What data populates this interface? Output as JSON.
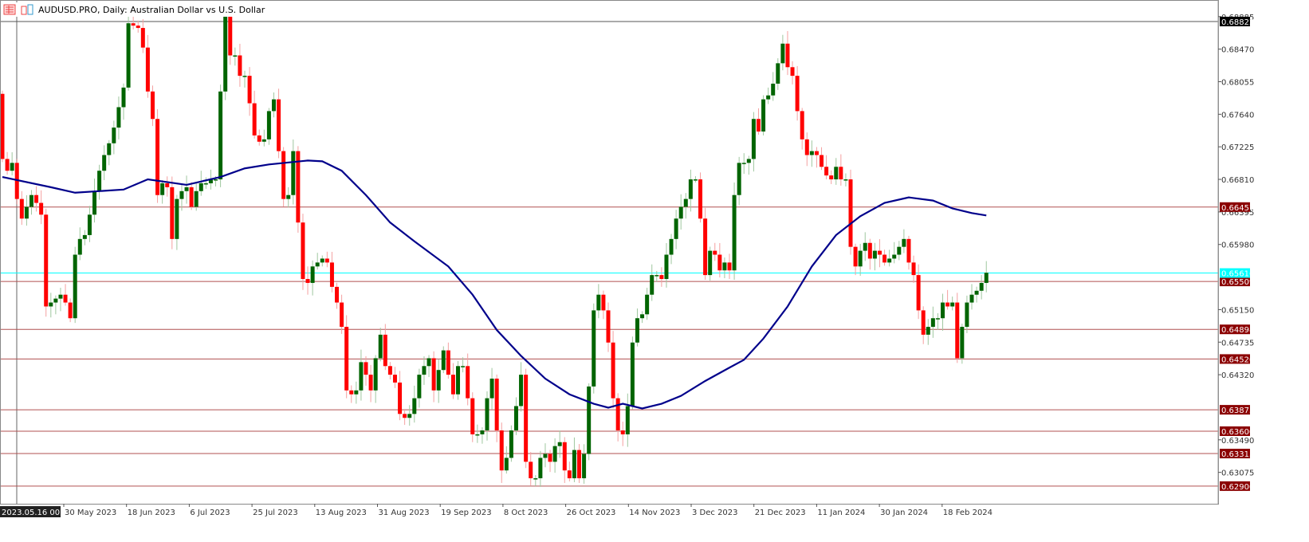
{
  "header": {
    "title": "AUDUSD.PRO, Daily:  Australian Dollar vs U.S. Dollar"
  },
  "colors": {
    "bull": "#006400",
    "bear": "#ff0000",
    "ma": "#00008b",
    "level": "#8b0000",
    "bid": "#00ffff",
    "grid_border": "#000000"
  },
  "chart_data": {
    "type": "candlestick",
    "symbol": "AUDUSD.PRO",
    "timeframe": "Daily",
    "ylim": [
      0.627,
      0.6905
    ],
    "closes": [
      0.6707,
      0.6692,
      0.6702,
      0.6656,
      0.6631,
      0.6646,
      0.6661,
      0.6651,
      0.6636,
      0.6519,
      0.6524,
      0.6529,
      0.6534,
      0.6524,
      0.6504,
      0.6585,
      0.6605,
      0.661,
      0.6636,
      0.6666,
      0.6692,
      0.6712,
      0.6727,
      0.6747,
      0.6773,
      0.6798,
      0.688,
      0.6877,
      0.6874,
      0.6849,
      0.6793,
      0.6758,
      0.6661,
      0.6676,
      0.6671,
      0.6605,
      0.6656,
      0.6666,
      0.6671,
      0.6646,
      0.6666,
      0.6676,
      0.6676,
      0.6681,
      0.6681,
      0.6793,
      0.689,
      0.6839,
      0.6839,
      0.6813,
      0.6813,
      0.6778,
      0.6737,
      0.6729,
      0.6732,
      0.6768,
      0.6783,
      0.6717,
      0.6656,
      0.6661,
      0.6717,
      0.6626,
      0.6554,
      0.6549,
      0.657,
      0.6575,
      0.658,
      0.6575,
      0.6544,
      0.6524,
      0.6493,
      0.6412,
      0.6407,
      0.6412,
      0.6448,
      0.6432,
      0.6412,
      0.6453,
      0.6483,
      0.6443,
      0.6432,
      0.6422,
      0.6382,
      0.6377,
      0.6382,
      0.6402,
      0.6432,
      0.6443,
      0.6453,
      0.6412,
      0.6438,
      0.6463,
      0.6432,
      0.6407,
      0.6443,
      0.6443,
      0.6402,
      0.6356,
      0.6356,
      0.6361,
      0.6402,
      0.6427,
      0.6361,
      0.631,
      0.6326,
      0.6361,
      0.6392,
      0.6432,
      0.6321,
      0.63,
      0.63,
      0.6326,
      0.6331,
      0.6321,
      0.6341,
      0.6346,
      0.631,
      0.63,
      0.6336,
      0.63,
      0.6331,
      0.6417,
      0.6514,
      0.6534,
      0.6514,
      0.6473,
      0.6402,
      0.6361,
      0.6356,
      0.6392,
      0.6473,
      0.6504,
      0.6509,
      0.6534,
      0.6559,
      0.6559,
      0.6554,
      0.6585,
      0.6605,
      0.6631,
      0.6646,
      0.6656,
      0.6681,
      0.6681,
      0.6631,
      0.6559,
      0.659,
      0.6585,
      0.6565,
      0.6575,
      0.6565,
      0.6661,
      0.6702,
      0.6702,
      0.6707,
      0.6758,
      0.6742,
      0.6783,
      0.6788,
      0.6803,
      0.6829,
      0.6854,
      0.6824,
      0.6813,
      0.6768,
      0.6732,
      0.6712,
      0.6717,
      0.6712,
      0.6697,
      0.6686,
      0.6681,
      0.6697,
      0.6681,
      0.6681,
      0.6595,
      0.657,
      0.659,
      0.66,
      0.658,
      0.659,
      0.6585,
      0.6575,
      0.658,
      0.6585,
      0.6595,
      0.6605,
      0.6575,
      0.6559,
      0.6514,
      0.6483,
      0.6493,
      0.6504,
      0.6504,
      0.6524,
      0.6519,
      0.6524,
      0.6453,
      0.6493,
      0.6524,
      0.6534,
      0.6539,
      0.6549,
      0.6562
    ],
    "first_open": 0.679,
    "moving_average": [
      [
        0,
        0.6684
      ],
      [
        10,
        0.6671
      ],
      [
        15,
        0.6664
      ],
      [
        25,
        0.6668
      ],
      [
        30,
        0.6681
      ],
      [
        38,
        0.6674
      ],
      [
        45,
        0.6684
      ],
      [
        50,
        0.6695
      ],
      [
        55,
        0.67
      ],
      [
        63,
        0.6705
      ],
      [
        66,
        0.6704
      ],
      [
        70,
        0.6692
      ],
      [
        75,
        0.6661
      ],
      [
        80,
        0.6626
      ],
      [
        85,
        0.6602
      ],
      [
        92,
        0.657
      ],
      [
        97,
        0.6534
      ],
      [
        102,
        0.6489
      ],
      [
        107,
        0.6456
      ],
      [
        112,
        0.6427
      ],
      [
        117,
        0.6407
      ],
      [
        122,
        0.6395
      ],
      [
        125,
        0.639
      ],
      [
        128,
        0.6395
      ],
      [
        132,
        0.6389
      ],
      [
        136,
        0.6395
      ],
      [
        140,
        0.6405
      ],
      [
        145,
        0.6424
      ],
      [
        150,
        0.6441
      ],
      [
        153,
        0.6451
      ],
      [
        157,
        0.6478
      ],
      [
        162,
        0.6519
      ],
      [
        167,
        0.657
      ],
      [
        172,
        0.661
      ],
      [
        177,
        0.6634
      ],
      [
        182,
        0.6651
      ],
      [
        187,
        0.6658
      ],
      [
        192,
        0.6654
      ],
      [
        196,
        0.6644
      ],
      [
        200,
        0.6638
      ],
      [
        203,
        0.6635
      ]
    ],
    "y_ticks": [
      "0.68885",
      "0.68470",
      "0.68055",
      "0.67640",
      "0.67225",
      "0.66810",
      "0.66395",
      "0.65980",
      "0.65150",
      "0.64735",
      "0.64320",
      "0.63490",
      "0.63075"
    ],
    "price_levels": [
      "0.66457",
      "0.65509",
      "0.64898",
      "0.64520",
      "0.63873",
      "0.63600",
      "0.63315",
      "0.62900"
    ],
    "top_level": "0.68822",
    "bid": "0.65616",
    "x_first_label": "2023.05.16 00:00",
    "x_labels": [
      "30 May 2023",
      "18 Jun 2023",
      "6 Jul 2023",
      "25 Jul 2023",
      "13 Aug 2023",
      "31 Aug 2023",
      "19 Sep 2023",
      "8 Oct 2023",
      "26 Oct 2023",
      "14 Nov 2023",
      "3 Dec 2023",
      "21 Dec 2023",
      "11 Jan 2024",
      "30 Jan 2024",
      "18 Feb 2024"
    ]
  }
}
